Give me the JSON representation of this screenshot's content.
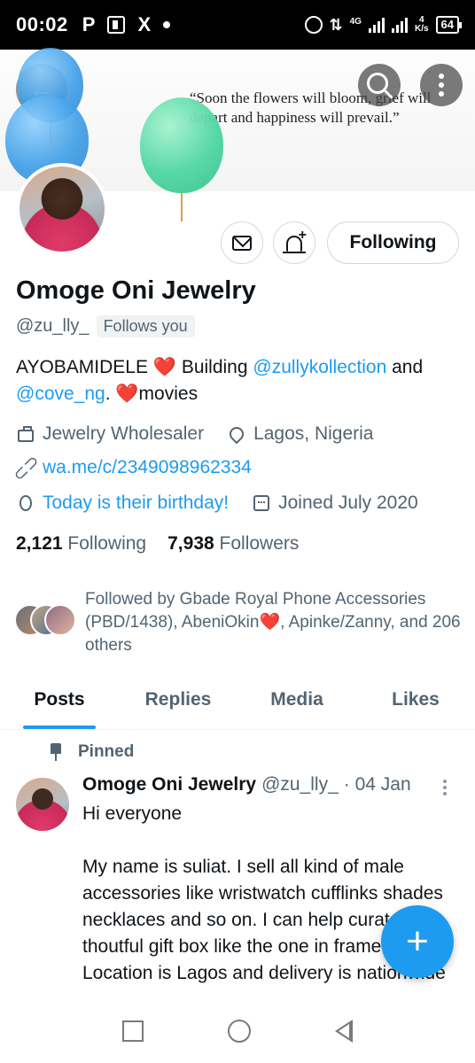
{
  "status_bar": {
    "time": "00:02",
    "app_icons": [
      "P",
      "X"
    ],
    "network": "4G",
    "speed_value": "4",
    "speed_unit": "K/s",
    "battery": "64"
  },
  "banner": {
    "quote": "“Soon the flowers will bloom, grief will depart and happiness will prevail.”"
  },
  "actions": {
    "following_label": "Following"
  },
  "profile": {
    "name": "Omoge Oni Jewelry",
    "handle": "@zu_lly_",
    "follows_you": "Follows you",
    "bio_part1": "AYOBAMIDELE ",
    "bio_heart1": "❤️",
    "bio_part2": " Building ",
    "bio_link1": "@zullykollection",
    "bio_part3": " and ",
    "bio_link2": "@cove_ng",
    "bio_part4": ". ",
    "bio_heart2": "❤️",
    "bio_part5": "movies",
    "category": "Jewelry Wholesaler",
    "location": "Lagos, Nigeria",
    "website": "wa.me/c/2349098962334",
    "birthday": "Today is their birthday!",
    "joined": "Joined July 2020",
    "following_count": "2,121",
    "following_label": "Following",
    "followers_count": "7,938",
    "followers_label": "Followers",
    "followed_by": "Followed by Gbade Royal Phone Accessories (PBD/1438), AbeniOkin❤️, Apinke/Zanny, and 206 others"
  },
  "tabs": [
    {
      "label": "Posts"
    },
    {
      "label": "Replies"
    },
    {
      "label": "Media"
    },
    {
      "label": "Likes"
    }
  ],
  "tweet": {
    "pinned_label": "Pinned",
    "author_name": "Omoge Oni Jewelry",
    "author_handle": "@zu_lly_",
    "date": "· 04 Jan",
    "line1": "Hi everyone",
    "line2": "My name is suliat. I sell all kind of male accessories like wristwatch cufflinks shades necklaces and so on. I can help curate thoutful gift box like the one in frame 4. Location is Lagos and delivery is nationwide"
  },
  "fab": {
    "label": "+"
  },
  "colors": {
    "accent": "#1d9bf0",
    "text_primary": "#0f1419",
    "text_secondary": "#536471",
    "heart": "#e0245e"
  }
}
